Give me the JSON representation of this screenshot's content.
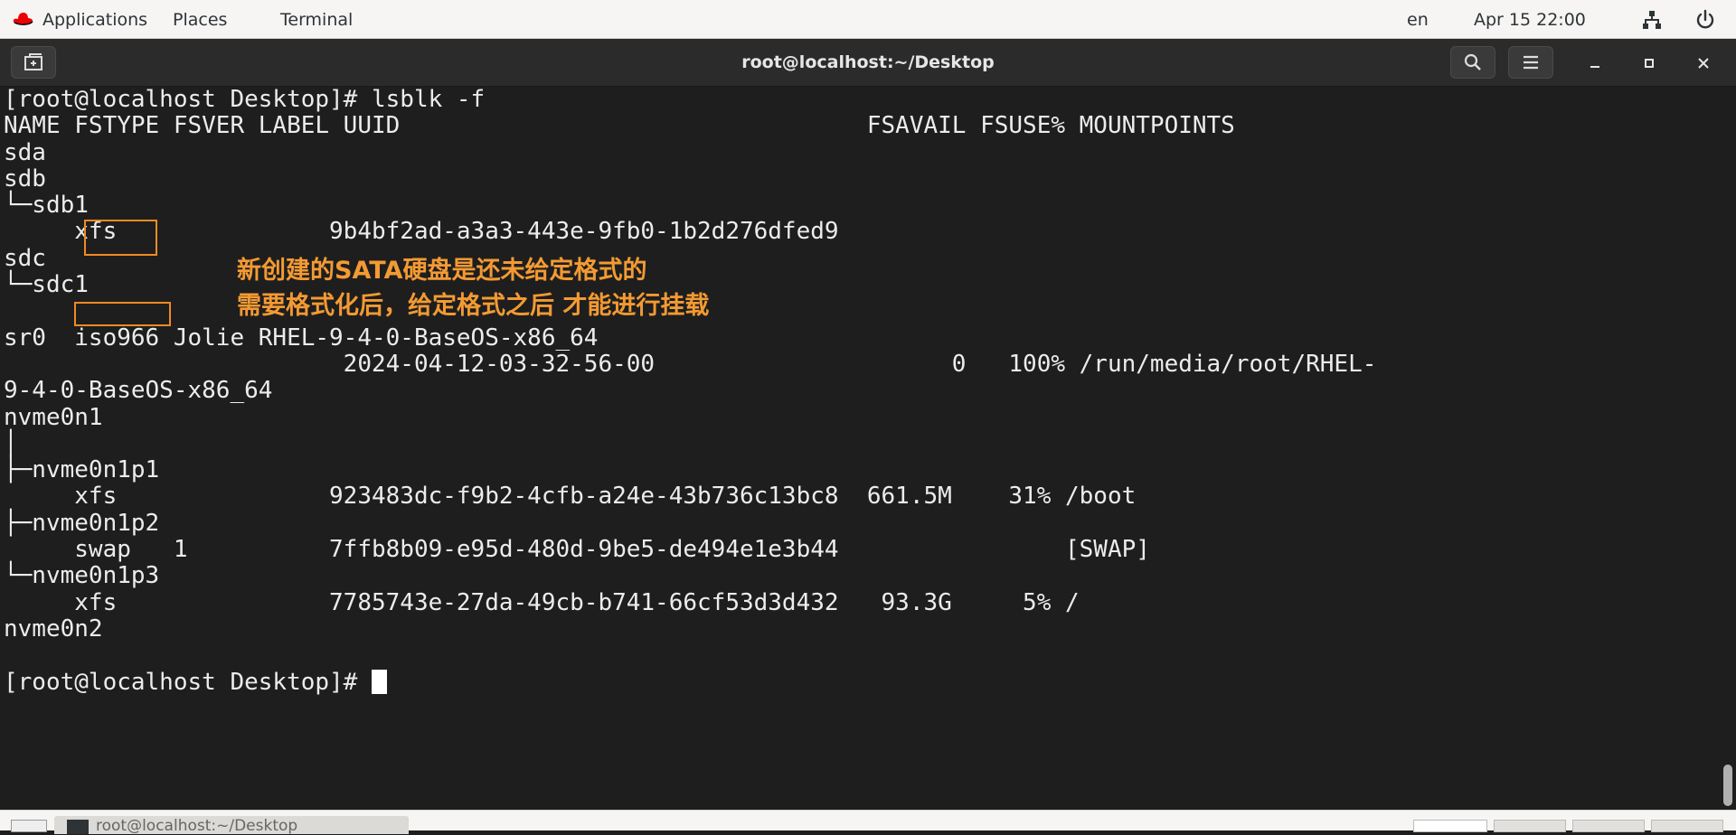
{
  "topbar": {
    "applications_label": "Applications",
    "places_label": "Places",
    "terminal_label": "Terminal",
    "input_language": "en",
    "clock": "Apr 15  22:00"
  },
  "window": {
    "title": "root@localhost:~/Desktop"
  },
  "terminal": {
    "lines": [
      "[root@localhost Desktop]# lsblk -f",
      "NAME FSTYPE FSVER LABEL UUID                                 FSAVAIL FSUSE% MOUNTPOINTS",
      "sda",
      "sdb",
      "└─sdb1",
      "     xfs               9b4bf2ad-a3a3-443e-9fb0-1b2d276dfed9",
      "sdc",
      "└─sdc1",
      "",
      "sr0  iso966 Jolie RHEL-9-4-0-BaseOS-x86_64",
      "                        2024-04-12-03-32-56-00                     0   100% /run/media/root/RHEL-",
      "9-4-0-BaseOS-x86_64",
      "nvme0n1",
      "│",
      "├─nvme0n1p1",
      "     xfs               923483dc-f9b2-4cfb-a24e-43b736c13bc8  661.5M    31% /boot",
      "├─nvme0n1p2",
      "     swap   1          7ffb8b09-e95d-480d-9be5-de494e1e3b44                [SWAP]",
      "└─nvme0n1p3",
      "     xfs               7785743e-27da-49cb-b741-66cf53d3d432   93.3G     5% /",
      "nvme0n2",
      "",
      "[root@localhost Desktop]# "
    ],
    "annotation": {
      "line1": "新创建的SATA硬盘是还未给定格式的",
      "line2": "需要格式化后，给定格式之后 才能进行挂载"
    }
  },
  "taskbar": {
    "window_label": "root@localhost:~/Desktop"
  },
  "colors": {
    "annotation": "#f39a33",
    "terminal_bg": "#1e1e1e",
    "terminal_fg": "#ececec"
  }
}
